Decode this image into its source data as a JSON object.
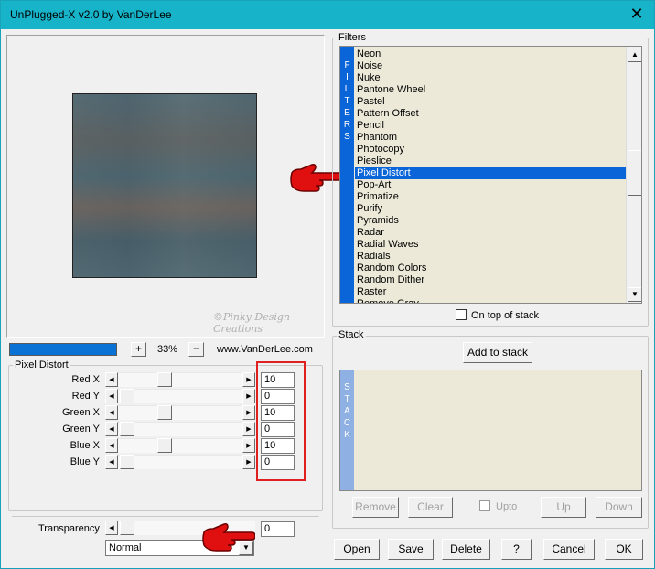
{
  "window": {
    "title": "UnPlugged-X v2.0 by VanDerLee",
    "close_glyph": "✕"
  },
  "preview": {
    "zoom_plus": "+",
    "zoom_minus": "−",
    "zoom_level": "33%",
    "website": "www.VanDerLee.com"
  },
  "filters": {
    "group_label": "Filters",
    "strip_letters": [
      "F",
      "I",
      "L",
      "T",
      "E",
      "R",
      "S"
    ],
    "items": [
      "Neon",
      "Noise",
      "Nuke",
      "Pantone Wheel",
      "Pastel",
      "Pattern Offset",
      "Pencil",
      "Phantom",
      "Photocopy",
      "Pieslice",
      "Pixel Distort",
      "Pop-Art",
      "Primatize",
      "Purify",
      "Pyramids",
      "Radar",
      "Radial Waves",
      "Radials",
      "Random Colors",
      "Random Dither",
      "Raster",
      "Remove Gray"
    ],
    "selected": "Pixel Distort",
    "on_top_of_stack_label": "On top of stack"
  },
  "stack": {
    "group_label": "Stack",
    "add_label": "Add to stack",
    "strip_letters": [
      "S",
      "T",
      "A",
      "C",
      "K"
    ],
    "remove_label": "Remove",
    "clear_label": "Clear",
    "upto_label": "Upto",
    "up_label": "Up",
    "down_label": "Down"
  },
  "pixel_distort": {
    "group_label": "Pixel Distort",
    "sliders": [
      {
        "label": "Red X",
        "value": "10",
        "level": 0.4
      },
      {
        "label": "Red Y",
        "value": "0",
        "level": 0.0
      },
      {
        "label": "Green X",
        "value": "10",
        "level": 0.4
      },
      {
        "label": "Green Y",
        "value": "0",
        "level": 0.0
      },
      {
        "label": "Blue X",
        "value": "10",
        "level": 0.4
      },
      {
        "label": "Blue Y",
        "value": "0",
        "level": 0.0
      }
    ]
  },
  "transparency": {
    "label": "Transparency",
    "value": "0",
    "blend_mode": "Normal"
  },
  "buttons": {
    "open": "Open",
    "save": "Save",
    "delete": "Delete",
    "help": "?",
    "cancel": "Cancel",
    "ok": "OK"
  },
  "watermark": "©Pinky Design Creations",
  "colors": {
    "titlebar": "#17b3c9",
    "selection": "#0a66d8",
    "highlight_box": "#e02020",
    "pointer_hand": "#e01010"
  },
  "icons": {
    "close": "close-icon",
    "pointer": "pointing-hand-icon"
  }
}
